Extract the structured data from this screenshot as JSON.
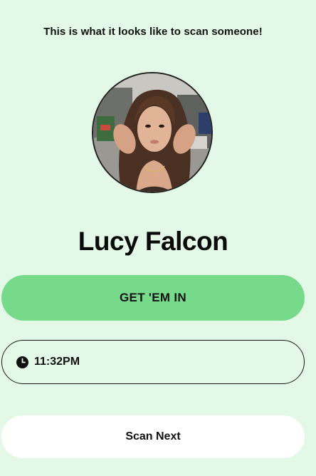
{
  "caption": "This is what it looks like to scan someone!",
  "profile": {
    "name": "Lucy Falcon",
    "photo_icon": "avatar-photo"
  },
  "actions": {
    "primary_label": "GET 'EM IN",
    "secondary_label": "Scan Next"
  },
  "timestamp": {
    "icon": "clock-icon",
    "time": "11:32PM"
  },
  "colors": {
    "background": "#e3f8e6",
    "primary_button": "#77d98a",
    "secondary_button": "#ffffff",
    "text": "#111111"
  }
}
